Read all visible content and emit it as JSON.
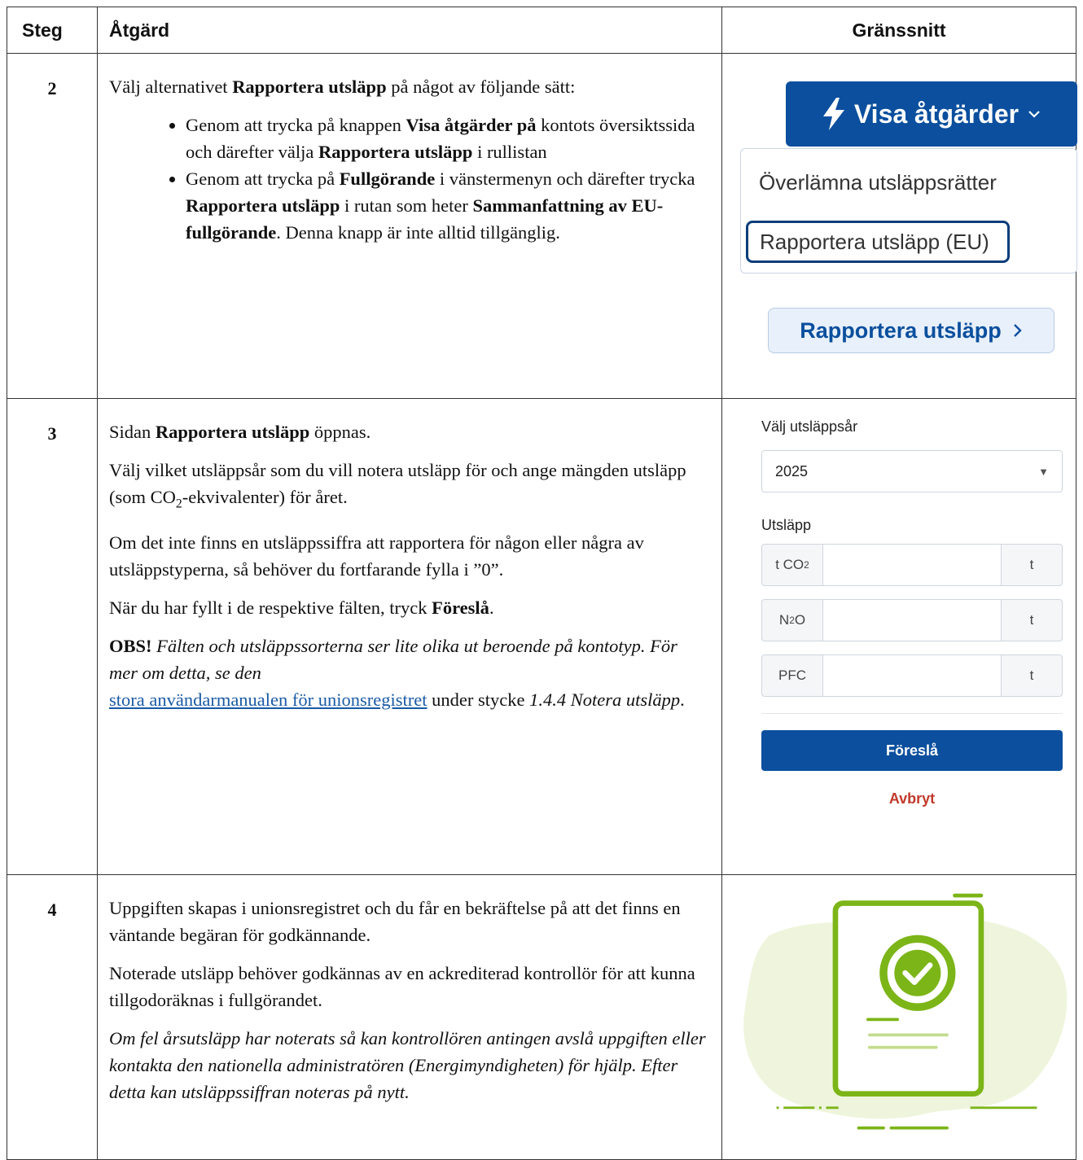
{
  "headers": {
    "steg": "Steg",
    "atgard": "Åtgärd",
    "granssnitt": "Gränssnitt"
  },
  "rows": [
    {
      "num": "2",
      "p1a": "Välj alternativet ",
      "p1b": "Rapportera utsläpp",
      "p1c": " på något av följande sätt:",
      "b1a": "Genom att trycka på knappen ",
      "b1b": "Visa åtgärder på",
      "b1c": " kontots översiktssida och därefter välja ",
      "b1d": "Rapportera utsläpp",
      "b1e": " i rullistan",
      "b2a": "Genom att trycka på ",
      "b2b": "Fullgörande",
      "b2c": " i vänstermenyn och därefter trycka ",
      "b2d": "Rapportera utsläpp",
      "b2e": " i rutan som heter ",
      "b2f": "Sammanfattning av EU-fullgörande",
      "b2g": ". Denna knapp är inte alltid tillgänglig.",
      "gui": {
        "visa_label": "Visa åtgärder",
        "dd_item1": "Överlämna utsläppsrätter",
        "dd_item2": "Rapportera utsläpp (EU)",
        "rapp_label": "Rapportera utsläpp"
      }
    },
    {
      "num": "3",
      "p1a": "Sidan ",
      "p1b": "Rapportera utsläpp",
      "p1c": " öppnas.",
      "p2a": "Välj vilket utsläppsår som du vill notera utsläpp för och ange mängden utsläpp (som CO",
      "p2sub": "2",
      "p2b": "-ekvivalenter) för året.",
      "p3": "Om det inte finns en utsläppssiffra att rapportera för någon eller några av utsläppstyperna, så behöver du fortfarande fylla i ”0”.",
      "p4a": "När du har fyllt i de respektive fälten, tryck ",
      "p4b": "Föreslå",
      "p4c": ".",
      "p5a": "OBS!",
      "p5b": " Fälten och utsläppssorterna ser lite olika ut beroende på kontotyp. För mer om detta, se den",
      "p5link": "stora användarmanualen för unionsregistret",
      "p5c": " under stycke ",
      "p5d": "1.4.4 Notera utsläpp",
      "p5e": ".",
      "form": {
        "year_label": "Välj utsläppsår",
        "year_value": "2025",
        "emission_label": "Utsläpp",
        "rows": [
          {
            "left": "t CO",
            "sub": "2",
            "unit": "t"
          },
          {
            "left": "N",
            "sub": "2",
            "left2": "O",
            "unit": "t"
          },
          {
            "left": "PFC",
            "unit": "t"
          }
        ],
        "submit": "Föreslå",
        "cancel": "Avbryt"
      }
    },
    {
      "num": "4",
      "p1": "Uppgiften skapas i unionsregistret och du får en bekräftelse på att det finns en väntande begäran för godkännande.",
      "p2": "Noterade utsläpp behöver godkännas av en ackrediterad kontrollör för att kunna tillgodoräknas i fullgörandet.",
      "p3": "Om fel årsutsläpp har noterats så kan kontrollören antingen avslå uppgiften eller kontakta den nationella administratören (Energimyndigheten) för hjälp. Efter detta kan utsläppssiffran noteras på nytt."
    }
  ],
  "colors": {
    "primary": "#0b4f9e",
    "cancel": "#c0392b",
    "illus_green": "#7cb518",
    "illus_bg": "#eef5dc"
  },
  "icons": {
    "visa": "lightning-icon",
    "visa_caret": "chevron-down-icon",
    "rapp_arrow": "chevron-right-icon",
    "select_caret": "caret-down-icon",
    "illustration": "document-check-icon"
  }
}
